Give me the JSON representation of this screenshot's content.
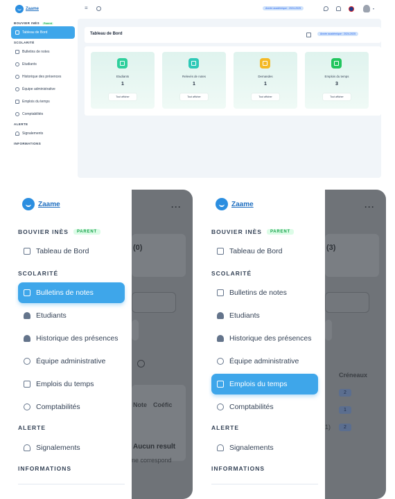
{
  "brand": {
    "name": "Zaame",
    "color": "#2b8ee0"
  },
  "desktop": {
    "topbar": {
      "menu_icon": "hamburger-icon",
      "search_icon": "search-icon",
      "year_pill": "Année académique : 2024-2025",
      "theme_icon": "moon-icon",
      "notif_icon": "bell-icon",
      "lang_icon": "flag-uk-icon",
      "user_icon": "avatar-icon"
    },
    "user": {
      "name": "BOUVIER INÈS",
      "role": "Parent"
    },
    "sidebar": {
      "items": [
        {
          "label": "Tableau de Bord",
          "active": true
        },
        {
          "section": "SCOLARITÉ"
        },
        {
          "label": "Bulletins de notes"
        },
        {
          "label": "Etudiants"
        },
        {
          "label": "Historique des présences"
        },
        {
          "label": "Équipe administrative"
        },
        {
          "label": "Emplois du temps"
        },
        {
          "label": "Comptabilités"
        },
        {
          "section": "ALERTE"
        },
        {
          "label": "Signalements"
        },
        {
          "section": "INFORMATIONS"
        }
      ]
    },
    "page": {
      "title": "Tableau de Bord",
      "year_pill": "Année académique : 2024-2025",
      "cards": [
        {
          "label": "Etudiants",
          "value": "1",
          "button": "Tout afficher",
          "icon_color": "#2fcf9c"
        },
        {
          "label": "Relevés de notes",
          "value": "1",
          "button": "Tout afficher",
          "icon_color": "#2ec9b7"
        },
        {
          "label": "Demandes",
          "value": "1",
          "button": "Tout afficher",
          "icon_color": "#f4b925"
        },
        {
          "label": "Emplois du temps",
          "value": "3",
          "button": "Tout afficher",
          "icon_color": "#22c55e"
        }
      ]
    }
  },
  "mobile": {
    "user": {
      "name": "BOUVIER INÈS",
      "role": "PARENT"
    },
    "sections": {
      "scolarite": "SCOLARITÉ",
      "alerte": "ALERTE",
      "informations": "INFORMATIONS"
    },
    "items": {
      "dashboard": "Tableau de Bord",
      "bulletins": "Bulletins de notes",
      "etudiants": "Etudiants",
      "presences": "Historique des présences",
      "equipe": "Équipe administrative",
      "emplois": "Emplois du temps",
      "compta": "Comptabilités",
      "signalements": "Signalements"
    },
    "screen1_bg": {
      "count": "(0)",
      "col_note": "Note",
      "col_coef": "Coéfic",
      "empty_title": "Aucun result",
      "empty_sub": "ne correspond"
    },
    "screen2_bg": {
      "count": "(3)",
      "col": "Créneaux",
      "badges": [
        "2",
        "1",
        "2"
      ],
      "row_tail": "1)"
    },
    "more_icon": "more-horizontal-icon"
  }
}
